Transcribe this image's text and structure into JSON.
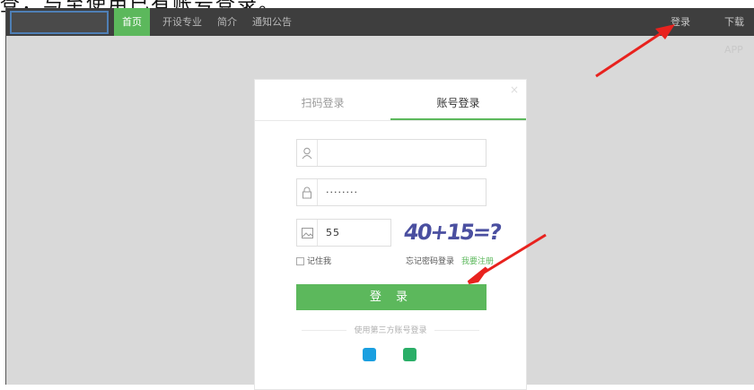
{
  "caption": "登，与至使用已有账号登录。",
  "nav": {
    "items": [
      {
        "label": "首页",
        "active": true
      },
      {
        "label": "开设专业",
        "active": false
      },
      {
        "label": "简介",
        "active": false
      },
      {
        "label": "通知公告",
        "active": false
      }
    ],
    "login_link": "登录",
    "download_link": "下载APP"
  },
  "modal": {
    "tab_qr": "扫码登录",
    "tab_account": "账号登录",
    "close": "×",
    "username_value": "",
    "password_value": "········",
    "captcha_value": "55",
    "captcha_image_text": "40+15=?",
    "remember_label": "记住我",
    "forgot_label": "忘记密码登录",
    "register_label": "我要注册",
    "login_button": "登 录",
    "third_party_label": "使用第三方账号登录"
  },
  "colors": {
    "accent": "#5cb85c",
    "arrow": "#e8221e"
  },
  "icons": [
    "user-icon",
    "lock-icon",
    "image-icon",
    "qq-icon",
    "wechat-icon"
  ]
}
